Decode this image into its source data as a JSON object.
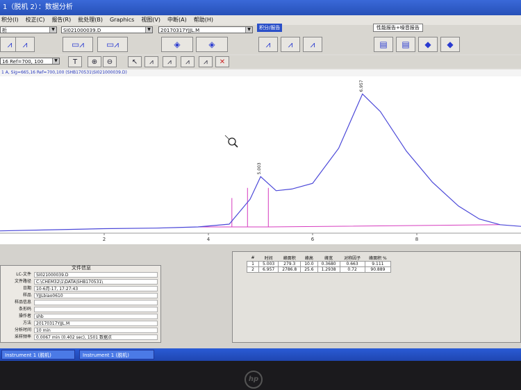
{
  "window": {
    "title": "1（脱机 2）：数据分析"
  },
  "menu": [
    "积分(I)",
    "校正(C)",
    "报告(R)",
    "批处理(B)",
    "Graphics",
    "视图(V)",
    "中断(A)",
    "帮助(H)"
  ],
  "selectors": {
    "left": "析",
    "file": "SI021000039.D",
    "method": "20170317YJJL.M",
    "group_integration": "积分/报告",
    "group_report": "性能报告+噪音报告"
  },
  "ref_combo": "16 Ref=700, 100",
  "signal_label": "1 A, Sig=665,16 Ref=700,100 (SHB170531\\SI021000039.D)",
  "chart_data": {
    "type": "line",
    "title": "",
    "xlabel": "",
    "ylabel": "",
    "x_ticks": [
      "2",
      "4",
      "6",
      "8"
    ],
    "xlim": [
      0,
      10
    ],
    "series": [
      {
        "x": [
          0,
          1,
          2,
          3,
          3.8,
          4.4,
          4.8,
          5.003,
          5.3,
          5.6,
          6.0,
          6.5,
          6.957,
          7.3,
          7.8,
          8.3,
          8.8,
          9.2,
          9.6,
          10
        ],
        "y": [
          4,
          6,
          8,
          9,
          11,
          16,
          60,
          100,
          75,
          78,
          88,
          150,
          246,
          215,
          145,
          90,
          48,
          25,
          15,
          12
        ]
      }
    ],
    "peak_labels": [
      "5.003",
      "6.957"
    ]
  },
  "file_info": {
    "header": "文件信息",
    "rows": [
      {
        "k": "LC-文件",
        "v": "SI021000039.D"
      },
      {
        "k": "文件路径",
        "v": "C:\\CHEM32\\1\\DATA\\SHB170531\\"
      },
      {
        "k": "日期",
        "v": "10-6月-17, 17:27:43"
      },
      {
        "k": "样品",
        "v": "YJJLbiao0610"
      },
      {
        "k": "样品信息",
        "v": ""
      },
      {
        "k": "条形码",
        "v": ""
      },
      {
        "k": "操作者",
        "v": "shb"
      },
      {
        "k": "方法",
        "v": "20170317YJJL.M"
      },
      {
        "k": "分析时间",
        "v": "10 min"
      },
      {
        "k": "采样频率",
        "v": "0.0067 min (0.402 sec), 1501 数据点"
      }
    ]
  },
  "peak_table": {
    "headers": [
      "#",
      "时间",
      "峰面积",
      "峰高",
      "峰宽",
      "对称因子",
      "峰面积 %"
    ],
    "rows": [
      [
        "1",
        "5.003",
        "279.3",
        "10.0",
        "0.3680",
        "0.663",
        "9.111"
      ],
      [
        "2",
        "6.957",
        "2786.8",
        "25.6",
        "1.2938",
        "0.72",
        "90.889"
      ]
    ]
  },
  "taskbar": [
    "Instrument 1 (脱机)",
    "Instrument 1 (脱机)"
  ]
}
